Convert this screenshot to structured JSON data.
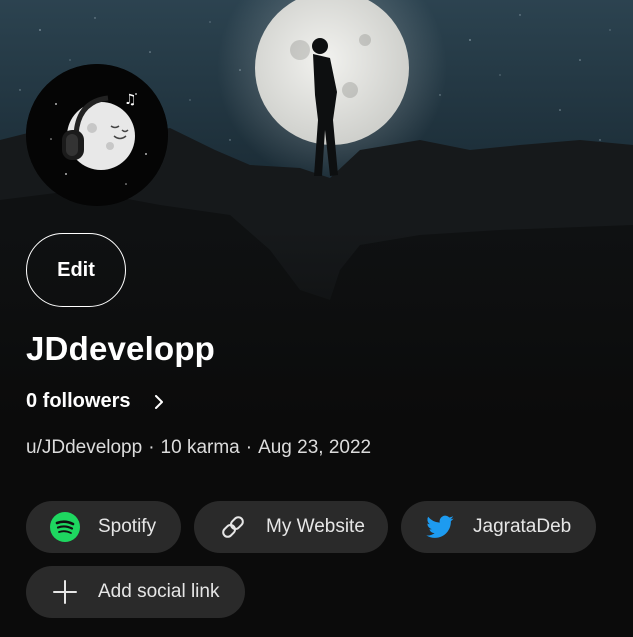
{
  "profile": {
    "edit_label": "Edit",
    "display_name": "JDdevelopp",
    "followers_label": "0 followers",
    "username": "u/JDdevelopp",
    "karma": "10 karma",
    "cake_day": "Aug 23, 2022"
  },
  "social_links": [
    {
      "label": "Spotify",
      "icon": "spotify-icon"
    },
    {
      "label": "My Website",
      "icon": "link-icon"
    },
    {
      "label": "JagrataDeb",
      "icon": "twitter-icon"
    }
  ],
  "add_social_link_label": "Add social link",
  "colors": {
    "background": "#0b0b0b",
    "pill": "#2a2a2a",
    "spotify": "#1ed760",
    "twitter": "#1d9bf0"
  }
}
